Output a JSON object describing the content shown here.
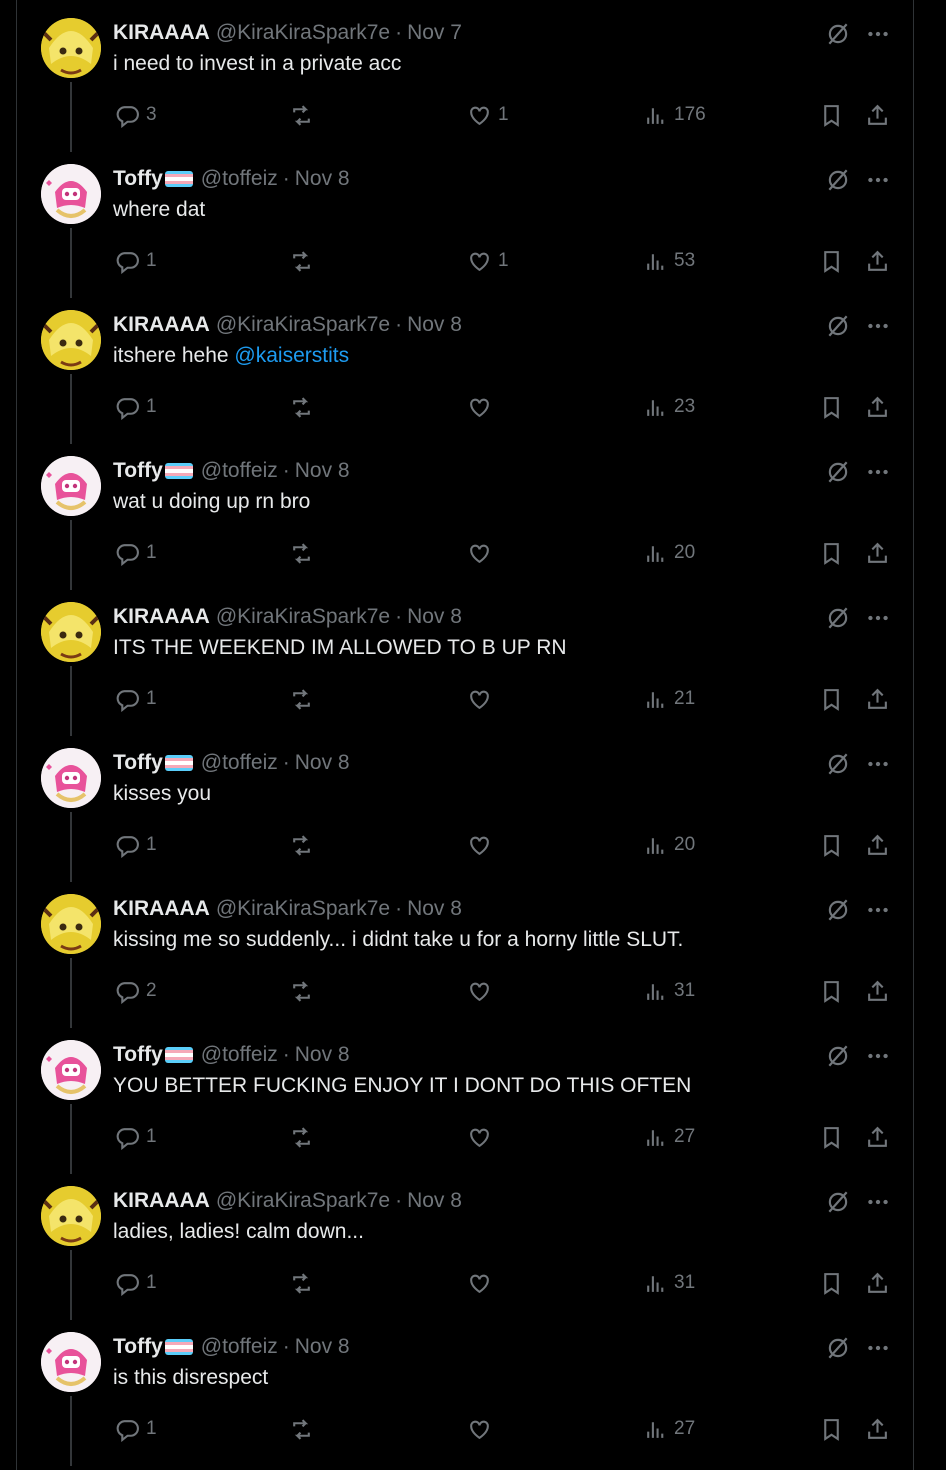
{
  "tweets": [
    {
      "author": "kira",
      "name": "KIRAAAA",
      "handle": "@KiraKiraSpark7e",
      "date": "Nov 7",
      "text": "i need to invest in a private acc",
      "mention": "",
      "replies": "3",
      "likes": "1",
      "views": "176"
    },
    {
      "author": "toffy",
      "name": "Toffy",
      "handle": "@toffeiz",
      "date": "Nov 8",
      "text": "where dat",
      "mention": "",
      "replies": "1",
      "likes": "1",
      "views": "53"
    },
    {
      "author": "kira",
      "name": "KIRAAAA",
      "handle": "@KiraKiraSpark7e",
      "date": "Nov 8",
      "text": "itshere hehe ",
      "mention": "@kaiserstits",
      "replies": "1",
      "likes": "",
      "views": "23"
    },
    {
      "author": "toffy",
      "name": "Toffy",
      "handle": "@toffeiz",
      "date": "Nov 8",
      "text": "wat u doing up rn bro",
      "mention": "",
      "replies": "1",
      "likes": "",
      "views": "20"
    },
    {
      "author": "kira",
      "name": "KIRAAAA",
      "handle": "@KiraKiraSpark7e",
      "date": "Nov 8",
      "text": "ITS THE WEEKEND IM ALLOWED TO B UP RN",
      "mention": "",
      "replies": "1",
      "likes": "",
      "views": "21"
    },
    {
      "author": "toffy",
      "name": "Toffy",
      "handle": "@toffeiz",
      "date": "Nov 8",
      "text": "kisses you",
      "mention": "",
      "replies": "1",
      "likes": "",
      "views": "20"
    },
    {
      "author": "kira",
      "name": "KIRAAAA",
      "handle": "@KiraKiraSpark7e",
      "date": "Nov 8",
      "text": "kissing me so suddenly... i didnt take u for a horny little SLUT.",
      "mention": "",
      "replies": "2",
      "likes": "",
      "views": "31"
    },
    {
      "author": "toffy",
      "name": "Toffy",
      "handle": "@toffeiz",
      "date": "Nov 8",
      "text": "YOU BETTER FUCKING ENJOY IT I DONT DO THIS OFTEN",
      "mention": "",
      "replies": "1",
      "likes": "",
      "views": "27"
    },
    {
      "author": "kira",
      "name": "KIRAAAA",
      "handle": "@KiraKiraSpark7e",
      "date": "Nov 8",
      "text": "ladies, ladies! calm down...",
      "mention": "",
      "replies": "1",
      "likes": "",
      "views": "31"
    },
    {
      "author": "toffy",
      "name": "Toffy",
      "handle": "@toffeiz",
      "date": "Nov 8",
      "text": "is this disrespect",
      "mention": "",
      "replies": "1",
      "likes": "",
      "views": "27"
    }
  ],
  "separator": "·",
  "icons": {
    "reply": "reply-icon",
    "retweet": "retweet-icon",
    "like": "heart-icon",
    "views": "views-icon",
    "bookmark": "bookmark-icon",
    "share": "share-icon",
    "grok": "grok-icon",
    "more": "more-icon"
  },
  "colors": {
    "background": "#000000",
    "text": "#e7e9ea",
    "muted": "#71767b",
    "link": "#1d9bf0",
    "border": "#2f3336"
  }
}
